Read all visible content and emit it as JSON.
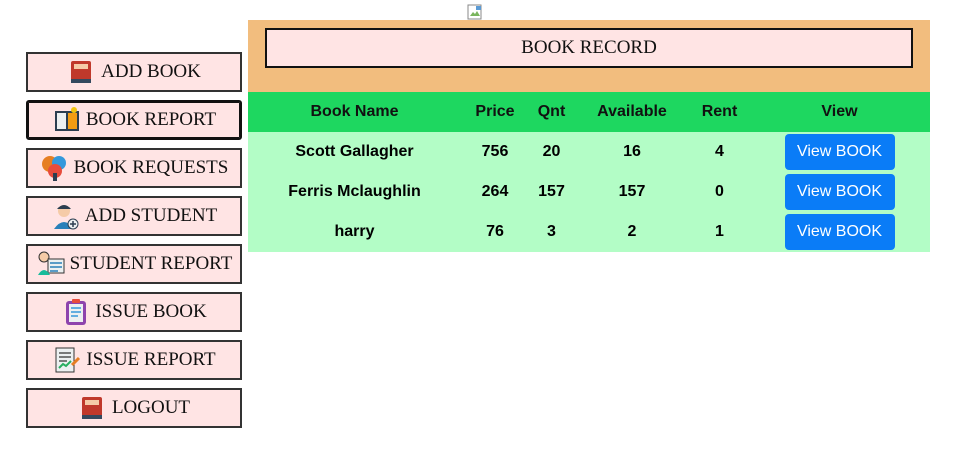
{
  "sidebar": {
    "items": [
      {
        "label": "ADD BOOK",
        "icon": "book-icon"
      },
      {
        "label": "BOOK REPORT",
        "icon": "report-icon"
      },
      {
        "label": "BOOK REQUESTS",
        "icon": "requests-icon"
      },
      {
        "label": "ADD STUDENT",
        "icon": "student-add-icon"
      },
      {
        "label": "STUDENT REPORT",
        "icon": "student-report-icon"
      },
      {
        "label": "ISSUE BOOK",
        "icon": "clipboard-icon"
      },
      {
        "label": "ISSUE REPORT",
        "icon": "issue-report-icon"
      },
      {
        "label": "LOGOUT",
        "icon": "logout-book-icon"
      }
    ]
  },
  "main": {
    "title": "BOOK RECORD",
    "table": {
      "headers": [
        "Book Name",
        "Price",
        "Qnt",
        "Available",
        "Rent",
        "View"
      ],
      "rows": [
        {
          "name": "Scott Gallagher",
          "price": "756",
          "qnt": "20",
          "available": "16",
          "rent": "4",
          "action": "View BOOK"
        },
        {
          "name": "Ferris Mclaughlin",
          "price": "264",
          "qnt": "157",
          "available": "157",
          "rent": "0",
          "action": "View BOOK"
        },
        {
          "name": "harry",
          "price": "76",
          "qnt": "3",
          "available": "2",
          "rent": "1",
          "action": "View BOOK"
        }
      ]
    }
  },
  "colors": {
    "sidebar_bg": "#ffe4e4",
    "header_band": "#f2bd7e",
    "table_header": "#1ed760",
    "table_row": "#b3fdc6",
    "button": "#0a7cf7"
  }
}
